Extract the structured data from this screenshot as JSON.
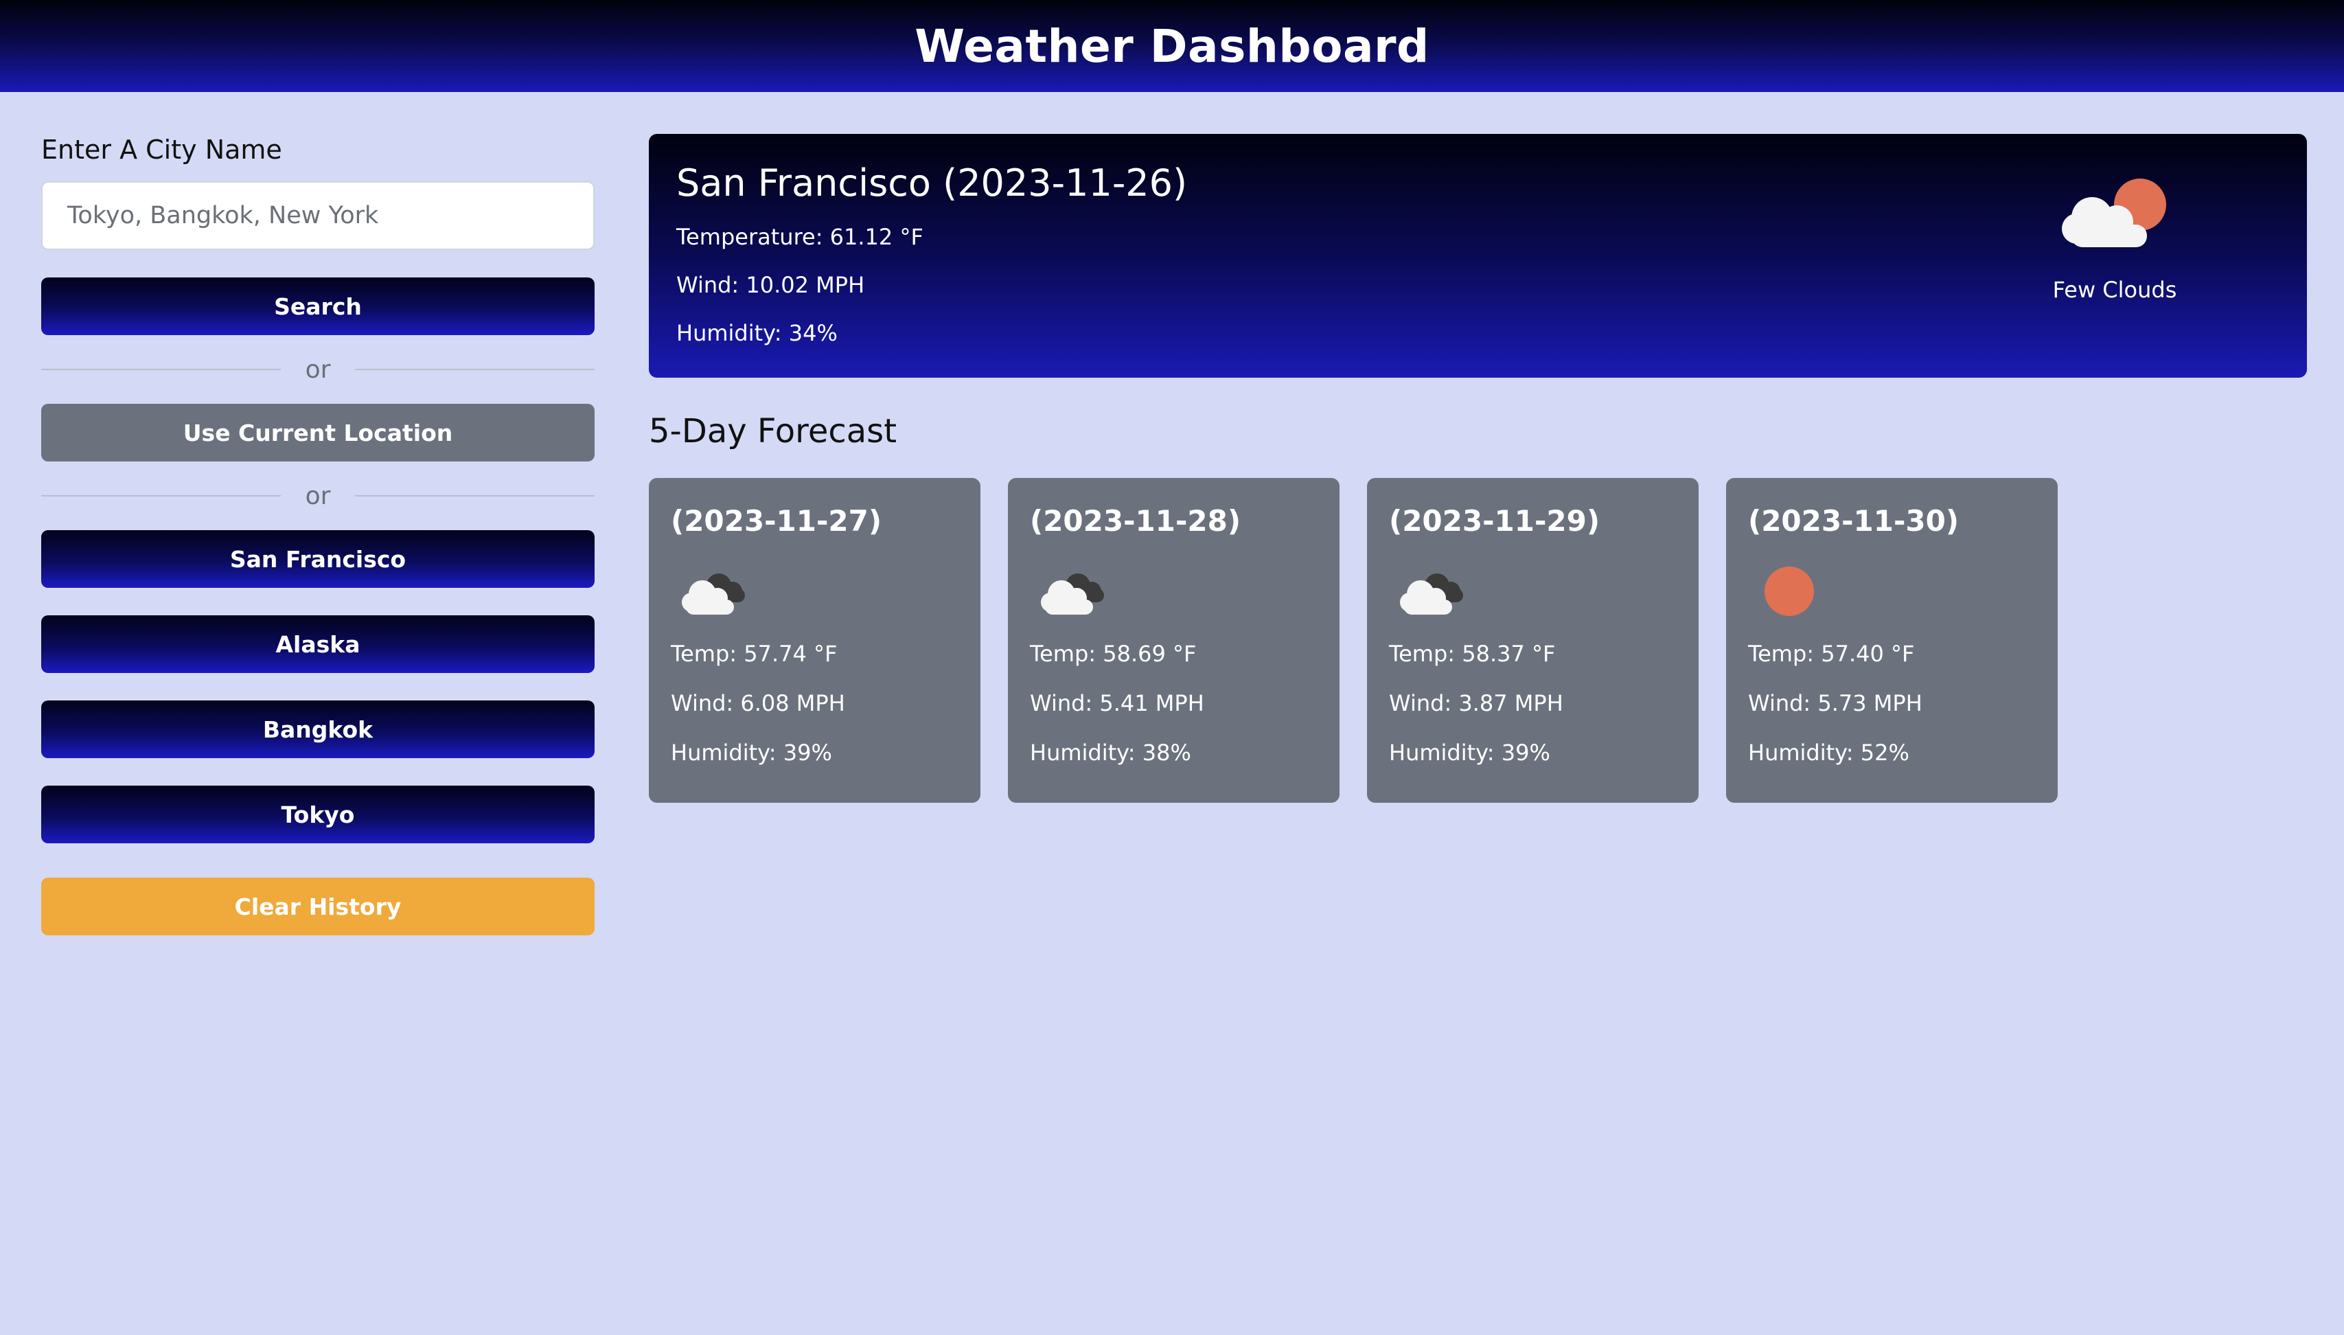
{
  "header": {
    "title": "Weather Dashboard"
  },
  "sidebar": {
    "search_label": "Enter A City Name",
    "search_placeholder": "Tokyo, Bangkok, New York",
    "search_button": "Search",
    "or_text": "or",
    "location_button": "Use Current Location",
    "history": [
      "San Francisco",
      "Alaska",
      "Bangkok",
      "Tokyo"
    ],
    "clear_button": "Clear History"
  },
  "current": {
    "title": "San Francisco (2023-11-26)",
    "temperature": "Temperature: 61.12 °F",
    "wind": "Wind: 10.02 MPH",
    "humidity": "Humidity: 34%",
    "description": "Few Clouds",
    "icon": "few-clouds-icon"
  },
  "forecast": {
    "title": "5-Day Forecast",
    "days": [
      {
        "date": "(2023-11-27)",
        "icon": "broken-clouds-icon",
        "temp": "Temp: 57.74 °F",
        "wind": "Wind: 6.08 MPH",
        "humidity": "Humidity: 39%"
      },
      {
        "date": "(2023-11-28)",
        "icon": "broken-clouds-icon",
        "temp": "Temp: 58.69 °F",
        "wind": "Wind: 5.41 MPH",
        "humidity": "Humidity: 38%"
      },
      {
        "date": "(2023-11-29)",
        "icon": "broken-clouds-icon",
        "temp": "Temp: 58.37 °F",
        "wind": "Wind: 3.87 MPH",
        "humidity": "Humidity: 39%"
      },
      {
        "date": "(2023-11-30)",
        "icon": "clear-sky-icon",
        "temp": "Temp: 57.40 °F",
        "wind": "Wind: 5.73 MPH",
        "humidity": "Humidity: 52%"
      }
    ]
  },
  "colors": {
    "page_background": "#d4daf5",
    "navy_accent": "#1a1ab6",
    "gray_card": "#6c727d",
    "orange_button": "#f0a93b",
    "sun": "#e07152"
  }
}
